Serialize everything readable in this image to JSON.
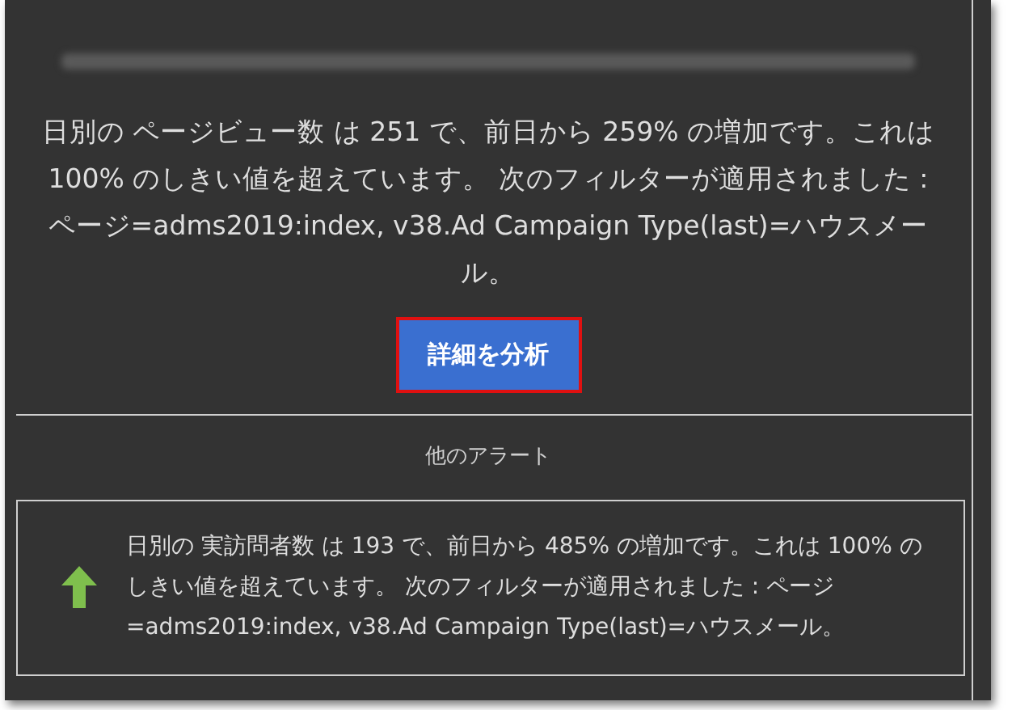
{
  "alert": {
    "message": "日別の ページビュー数 は 251 で、前日から 259% の増加です。これは 100% のしきい値を超えています。 次のフィルターが適用されました : ページ=adms2019:index, v38.Ad Campaign Type(last)=ハウスメール。",
    "button": "詳細を分析"
  },
  "other_alerts": {
    "title": "他のアラート",
    "items": [
      {
        "kind": "up",
        "message": "日別の 実訪問者数 は 193 で、前日から 485% の増加です。これは 100% のしきい値を超えています。 次のフィルターが適用されました : ページ=adms2019:index, v38.Ad Campaign Type(last)=ハウスメール。"
      }
    ]
  }
}
